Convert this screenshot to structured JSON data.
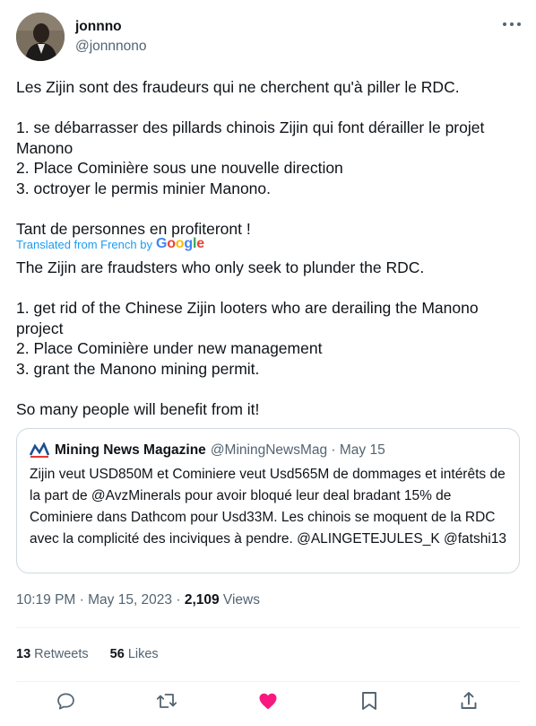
{
  "tweet": {
    "display_name": "jonnno",
    "handle": "@jonnnono",
    "original_text": "Les Zijin sont des fraudeurs qui ne cherchent qu'à piller le RDC.\n\n1. se débarrasser des pillards chinois Zijin qui font dérailler le projet Manono\n2. Place Cominière sous une nouvelle direction\n3. octroyer le permis minier Manono.\n\nTant de personnes en profiteront !",
    "translated_label": "Translated from French by",
    "translator": "Google",
    "translated_text": "The Zijin are fraudsters who only seek to plunder the RDC.\n\n1. get rid of the Chinese Zijin looters who are derailing the Manono project\n2. Place Cominière under new management\n3. grant the Manono mining permit.\n\nSo many people will benefit from it!",
    "timestamp": "10:19 PM · May 15, 2023 · ",
    "views_count": "2,109",
    "views_label": " Views"
  },
  "quote": {
    "name": "Mining News Magazine",
    "handle_date": "@MiningNewsMag · May 15",
    "text": "Zijin veut USD850M et Cominiere veut Usd565M de dommages et intérêts de la part de @AvzMinerals pour avoir bloqué leur deal bradant 15% de Cominiere dans Dathcom pour Usd33M. Les chinois se moquent de la RDC avec la complicité des inciviques à pendre. @ALINGETEJULES_K @fatshi13"
  },
  "stats": {
    "retweets_count": "13",
    "retweets_label": " Retweets",
    "likes_count": "56",
    "likes_label": " Likes"
  },
  "icons": {
    "reply": "reply-icon",
    "retweet": "retweet-icon",
    "like": "heart-icon",
    "bookmark": "bookmark-icon",
    "share": "share-icon",
    "more": "more-icon"
  },
  "colors": {
    "link": "#1d9bf0",
    "secondary": "#536471",
    "like": "#f91880",
    "border": "#cfd9de"
  }
}
